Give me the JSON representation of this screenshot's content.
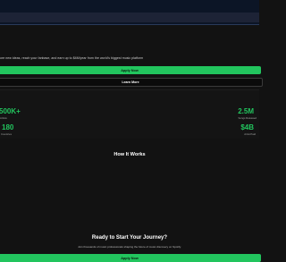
{
  "hero": {
    "subtitle": "ore new ideas, reach your fanbase, and earn up to $4M/year from the world's biggest music platform",
    "primary_cta": "Apply Now",
    "secondary_cta": "Learn More"
  },
  "stats": [
    {
      "value": "500K+",
      "label": "Artists"
    },
    {
      "value": "2.5M",
      "label": "Songs Released"
    },
    {
      "value": "180",
      "label": "Countries"
    },
    {
      "value": "$4B",
      "label": "Artist Paid"
    }
  ],
  "how_it_works": {
    "title": "How It Works"
  },
  "cta": {
    "title": "Ready to Start Your Journey?",
    "subtitle": "Join thousands of music professionals shaping the future of music discovery on Spotify.",
    "button": "Apply Now"
  },
  "colors": {
    "accent": "#22c55e",
    "background": "#121212",
    "nav": "#0c1526"
  }
}
